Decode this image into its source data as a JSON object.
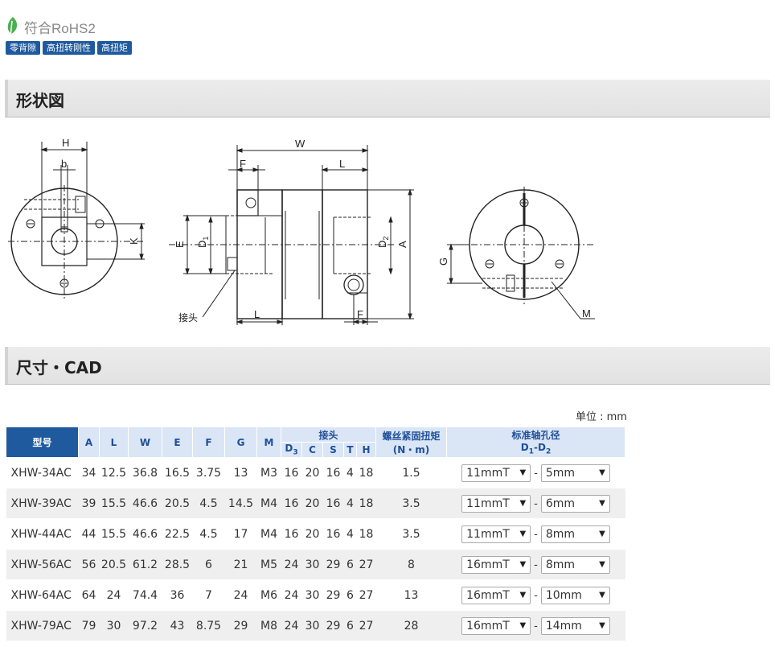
{
  "header": {
    "rohs_label": "符合RoHS2",
    "badges": [
      "零背隙",
      "高扭转刚性",
      "高扭矩"
    ]
  },
  "sections": {
    "shape": "形状図",
    "cad": "尺寸・CAD"
  },
  "drawing": {
    "labels": {
      "H": "H",
      "b": "b",
      "K": "K",
      "W": "W",
      "F": "F",
      "L": "L",
      "E": "E",
      "D1": "D",
      "D1_sub": "1",
      "D2": "D",
      "D2_sub": "2",
      "A": "A",
      "G": "G",
      "M": "M",
      "joint": "接头"
    }
  },
  "unit": "单位 : mm",
  "table": {
    "headers": {
      "model": "型号",
      "A": "A",
      "L": "L",
      "W": "W",
      "E": "E",
      "F": "F",
      "G": "G",
      "M": "M",
      "joint": "接头",
      "D3": "D",
      "D3_sub": "3",
      "C": "C",
      "S": "S",
      "T": "T",
      "H": "H",
      "torque": "螺丝紧固扭矩",
      "torque_unit": "(N・m)",
      "bore": "标准轴孔径",
      "bore_sub": "D",
      "bore_sub1": "1",
      "bore_dash": "-D",
      "bore_sub2": "2"
    },
    "rows": [
      {
        "model": "XHW-34AC",
        "A": "34",
        "L": "12.5",
        "W": "36.8",
        "E": "16.5",
        "F": "3.75",
        "G": "13",
        "M": "M3",
        "D3": "16",
        "C": "20",
        "S": "16",
        "T": "4",
        "H": "18",
        "torque": "1.5",
        "d1": "11mmT",
        "d2": "5mm"
      },
      {
        "model": "XHW-39AC",
        "A": "39",
        "L": "15.5",
        "W": "46.6",
        "E": "20.5",
        "F": "4.5",
        "G": "14.5",
        "M": "M4",
        "D3": "16",
        "C": "20",
        "S": "16",
        "T": "4",
        "H": "18",
        "torque": "3.5",
        "d1": "11mmT",
        "d2": "6mm"
      },
      {
        "model": "XHW-44AC",
        "A": "44",
        "L": "15.5",
        "W": "46.6",
        "E": "22.5",
        "F": "4.5",
        "G": "17",
        "M": "M4",
        "D3": "16",
        "C": "20",
        "S": "16",
        "T": "4",
        "H": "18",
        "torque": "3.5",
        "d1": "11mmT",
        "d2": "8mm"
      },
      {
        "model": "XHW-56AC",
        "A": "56",
        "L": "20.5",
        "W": "61.2",
        "E": "28.5",
        "F": "6",
        "G": "21",
        "M": "M5",
        "D3": "24",
        "C": "30",
        "S": "29",
        "T": "6",
        "H": "27",
        "torque": "8",
        "d1": "16mmT",
        "d2": "8mm"
      },
      {
        "model": "XHW-64AC",
        "A": "64",
        "L": "24",
        "W": "74.4",
        "E": "36",
        "F": "7",
        "G": "24",
        "M": "M6",
        "D3": "24",
        "C": "30",
        "S": "29",
        "T": "6",
        "H": "27",
        "torque": "13",
        "d1": "16mmT",
        "d2": "10mm"
      },
      {
        "model": "XHW-79AC",
        "A": "79",
        "L": "30",
        "W": "97.2",
        "E": "43",
        "F": "8.75",
        "G": "29",
        "M": "M8",
        "D3": "24",
        "C": "30",
        "S": "29",
        "T": "6",
        "H": "27",
        "torque": "28",
        "d1": "16mmT",
        "d2": "14mm"
      }
    ]
  },
  "colors": {
    "badge_bg": "#1f5a9e",
    "header_cell_bg": "#dae6f6",
    "header_text": "#1f4f99",
    "leaf": "#4caf50"
  }
}
